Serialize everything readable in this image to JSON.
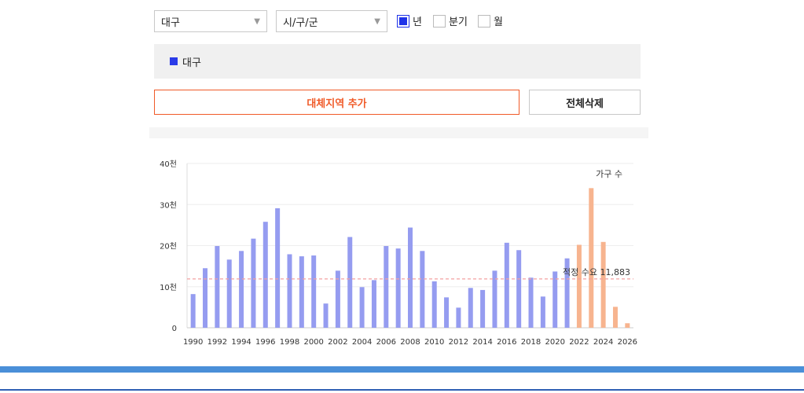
{
  "filters": {
    "region_select": "대구",
    "district_select": "시/구/군",
    "period_options": [
      {
        "label": "년",
        "checked": true
      },
      {
        "label": "분기",
        "checked": false
      },
      {
        "label": "월",
        "checked": false
      }
    ]
  },
  "legend_panel": {
    "item": "대구",
    "color": "#2a3be8"
  },
  "buttons": {
    "add_label": "대체지역 추가",
    "delete_label": "전체삭제"
  },
  "colors": {
    "actual": "#959cf0",
    "forecast": "#f7b48f",
    "reference": "#f4a0a0",
    "accent": "#f05a28"
  },
  "chart_data": {
    "type": "bar",
    "annotation": "가구 수",
    "reference_line": {
      "label": "적정 수요 11,883",
      "value": 11883
    },
    "ylim": [
      0,
      40000
    ],
    "y_ticks": [
      {
        "value": 0,
        "label": "0"
      },
      {
        "value": 10000,
        "label": "10천"
      },
      {
        "value": 20000,
        "label": "20천"
      },
      {
        "value": 30000,
        "label": "30천"
      },
      {
        "value": 40000,
        "label": "40천"
      }
    ],
    "x_tick_labels": [
      "1990",
      "1992",
      "1994",
      "1996",
      "1998",
      "2000",
      "2002",
      "2004",
      "2006",
      "2008",
      "2010",
      "2012",
      "2014",
      "2016",
      "2018",
      "2020",
      "2022",
      "2024",
      "2026"
    ],
    "years": [
      1990,
      1991,
      1992,
      1993,
      1994,
      1995,
      1996,
      1997,
      1998,
      1999,
      2000,
      2001,
      2002,
      2003,
      2004,
      2005,
      2006,
      2007,
      2008,
      2009,
      2010,
      2011,
      2012,
      2013,
      2014,
      2015,
      2016,
      2017,
      2018,
      2019,
      2020,
      2021,
      2022,
      2023,
      2024,
      2025,
      2026
    ],
    "values": [
      8200,
      14500,
      19900,
      16600,
      18700,
      21700,
      25800,
      29100,
      17900,
      17400,
      17600,
      5900,
      13900,
      22100,
      9900,
      11600,
      19900,
      19300,
      24400,
      18700,
      11300,
      7400,
      4900,
      9700,
      9200,
      13900,
      20700,
      18900,
      12200,
      7600,
      13700,
      16900,
      20200,
      34000,
      20900,
      5100,
      1100
    ],
    "forecast_from": 2022
  }
}
